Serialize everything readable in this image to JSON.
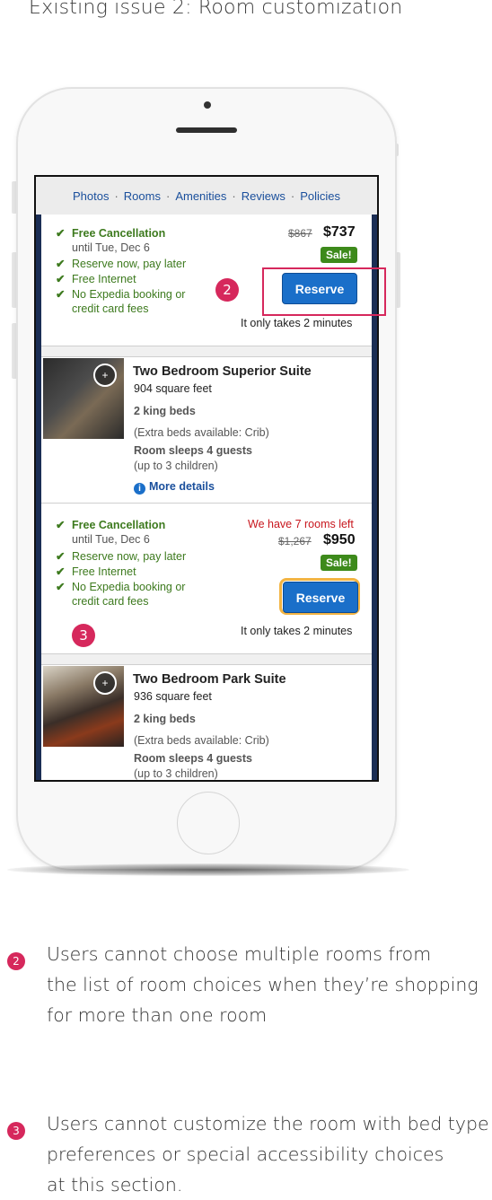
{
  "heading": "Existing issue 2: Room customization",
  "nav": {
    "items": [
      "Photos",
      "Rooms",
      "Amenities",
      "Reviews",
      "Policies"
    ]
  },
  "offer1": {
    "free_cancellation": "Free Cancellation",
    "until": "until Tue, Dec 6",
    "perks": [
      "Reserve now, pay later",
      "Free Internet",
      "No Expedia booking or"
    ],
    "perk_cont": "credit card fees",
    "old_price": "$867",
    "price": "$737",
    "sale": "Sale!",
    "reserve": "Reserve",
    "takes": "It only takes 2 minutes"
  },
  "room1": {
    "name": "Two Bedroom Superior Suite",
    "sqft": "904 square feet",
    "beds": "2 king beds",
    "extra": "(Extra beds available: Crib)",
    "sleeps": "Room sleeps 4 guests",
    "children": "(up to 3 children)",
    "more": "More details"
  },
  "offer2": {
    "free_cancellation": "Free Cancellation",
    "until": "until Tue, Dec 6",
    "perks": [
      "Reserve now, pay later",
      "Free Internet",
      "No Expedia booking or"
    ],
    "perk_cont": "credit card fees",
    "rooms_left": "We have 7 rooms left",
    "old_price": "$1,267",
    "price": "$950",
    "sale": "Sale!",
    "reserve": "Reserve",
    "takes": "It only takes 2 minutes"
  },
  "room2": {
    "name": "Two Bedroom Park Suite",
    "sqft": "936 square feet",
    "beds": "2 king beds",
    "extra": "(Extra beds available: Crib)",
    "sleeps": "Room sleeps 4 guests",
    "children": "(up to 3 children)"
  },
  "markers": {
    "m2": "2",
    "m3": "3"
  },
  "notes": [
    {
      "num": "2",
      "lines": [
        "Users cannot choose multiple rooms from",
        "the list of room choices when they’re shopping",
        "for more than one room"
      ]
    },
    {
      "num": "3",
      "lines": [
        "Users cannot customize the room with bed type",
        "preferences or special accessibility choices",
        "at this section."
      ]
    }
  ],
  "colors": {
    "accent": "#d6285c",
    "reserve": "#1a6fc9",
    "sale": "#3d8a1b",
    "highlight": "#f3b442"
  }
}
